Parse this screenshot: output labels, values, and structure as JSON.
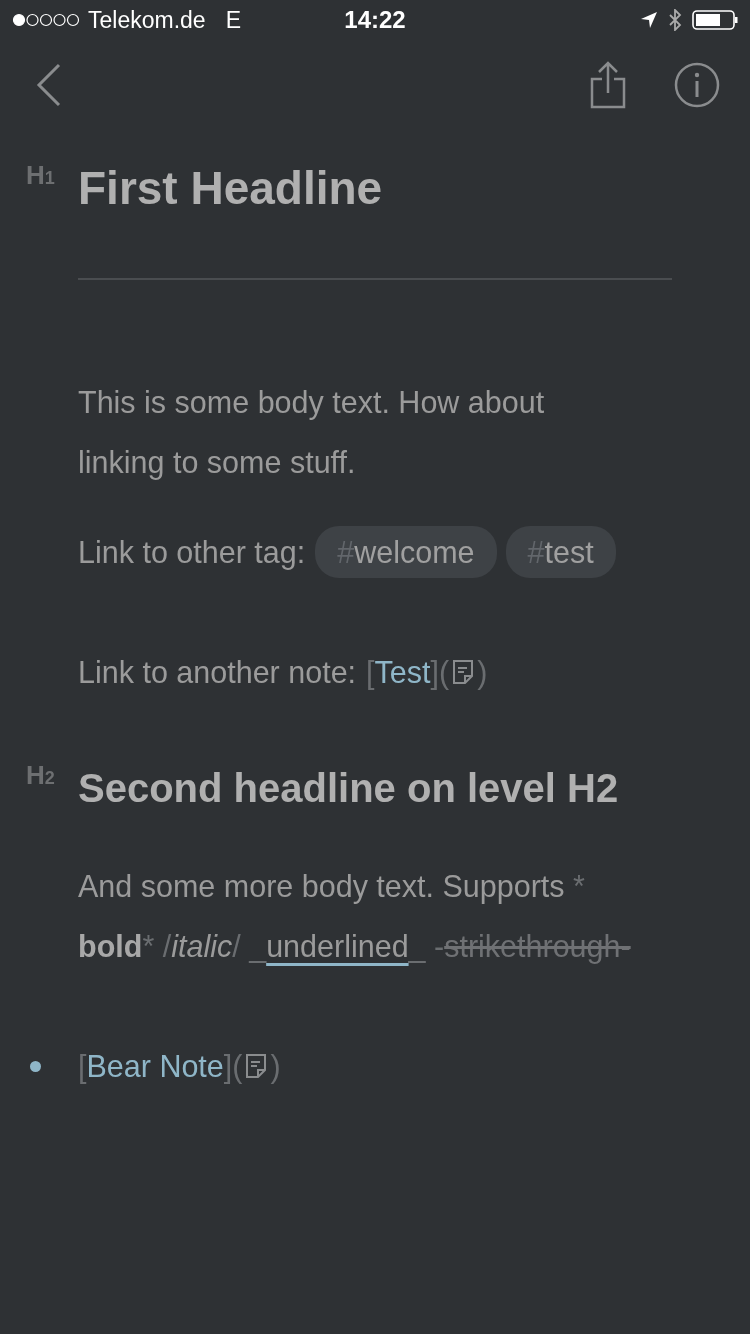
{
  "status_bar": {
    "carrier": "Telekom.de",
    "network": "E",
    "time": "14:22"
  },
  "editor": {
    "blocks": [
      {
        "kind": "heading",
        "marker": "H$_{1}$",
        "text": "First Headline"
      },
      {
        "kind": "rule"
      },
      {
        "kind": "paragraph",
        "segments": [
          {
            "kind": "plain",
            "text": "This is some body text. How about linking to some stuff."
          }
        ]
      },
      {
        "kind": "tags",
        "label": "Link to other tag:",
        "tags": [
          {
            "hash": "#",
            "name": "welcome"
          },
          {
            "hash": "#",
            "name": "test"
          }
        ]
      },
      {
        "kind": "note_link",
        "label": "Link to another note:",
        "open": "[",
        "link": "Test",
        "middle": "](",
        "close": ")"
      },
      {
        "kind": "heading",
        "marker": "H$_{2}$",
        "text": "Second headline on level H2"
      },
      {
        "kind": "paragraph",
        "segments": [
          {
            "kind": "plain",
            "text": "And some more body text. Supports "
          },
          {
            "kind": "marker",
            "text": "*"
          },
          {
            "kind": "bold",
            "text": "bold"
          },
          {
            "kind": "marker",
            "text": "* /"
          },
          {
            "kind": "italic",
            "text": "italic"
          },
          {
            "kind": "marker",
            "text": "/ _"
          },
          {
            "kind": "underline",
            "text": "underlined"
          },
          {
            "kind": "marker",
            "text": "_ -"
          },
          {
            "kind": "strike",
            "text": "strikethrough-"
          }
        ]
      },
      {
        "kind": "bullet_link",
        "open": "[",
        "link": "Bear Note",
        "middle": "](",
        "close": ")"
      }
    ]
  }
}
